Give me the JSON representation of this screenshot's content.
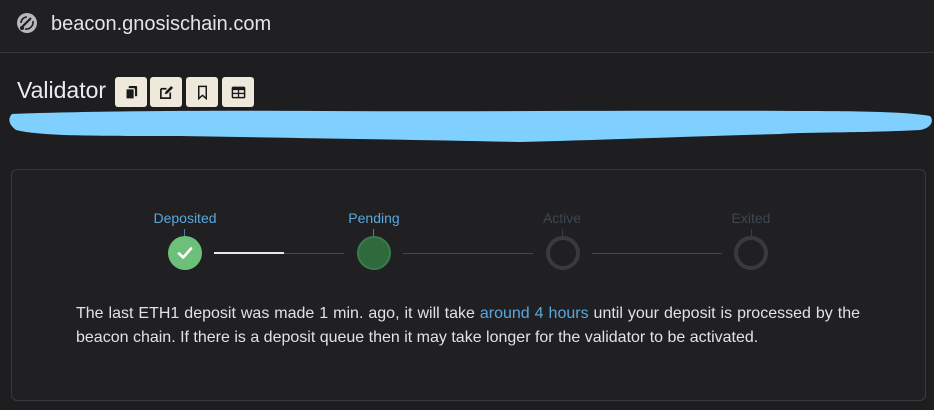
{
  "browser": {
    "site_title": "beacon.gnosischain.com",
    "icon": "satellite-icon"
  },
  "header": {
    "title": "Validator",
    "tools": [
      {
        "name": "copy-icon"
      },
      {
        "name": "edit-icon"
      },
      {
        "name": "bookmark-icon"
      },
      {
        "name": "table-icon"
      }
    ],
    "redaction_color": "#7fd0ff"
  },
  "progress": {
    "steps": [
      {
        "label": "Deposited",
        "state": "complete"
      },
      {
        "label": "Pending",
        "state": "current"
      },
      {
        "label": "Active",
        "state": "upcoming"
      },
      {
        "label": "Exited",
        "state": "upcoming"
      }
    ]
  },
  "message": {
    "before": "The last ETH1 deposit was made 1 min. ago, it will take ",
    "link": "around 4 hours",
    "after": " until your deposit is processed by the beacon chain. If there is a deposit queue then it may take longer for the validator to be activated."
  },
  "colors": {
    "background": "#1e1e20",
    "accent": "#5aa7e0",
    "success": "#6cc07a",
    "pending": "#2f6a3c",
    "button_bg": "#efe9dc"
  }
}
